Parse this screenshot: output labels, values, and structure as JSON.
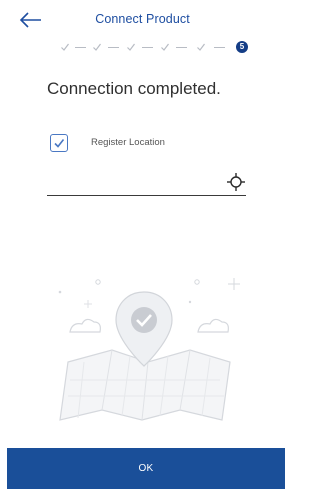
{
  "header": {
    "title": "Connect Product",
    "back_icon": "back-arrow-icon"
  },
  "stepper": {
    "completed_steps": 4,
    "current_step": "5",
    "completed_icon": "check-icon"
  },
  "main": {
    "heading": "Connection completed.",
    "register_location": {
      "label": "Register Location",
      "checked": true
    },
    "location_field": {
      "value": "",
      "action_icon": "locate-target-icon"
    },
    "illustration_icon": "map-location-pin-check-icon"
  },
  "footer": {
    "ok_label": "OK"
  },
  "colors": {
    "accent": "#1e4ea1",
    "button": "#1a4f99",
    "current_step": "#143d86"
  }
}
